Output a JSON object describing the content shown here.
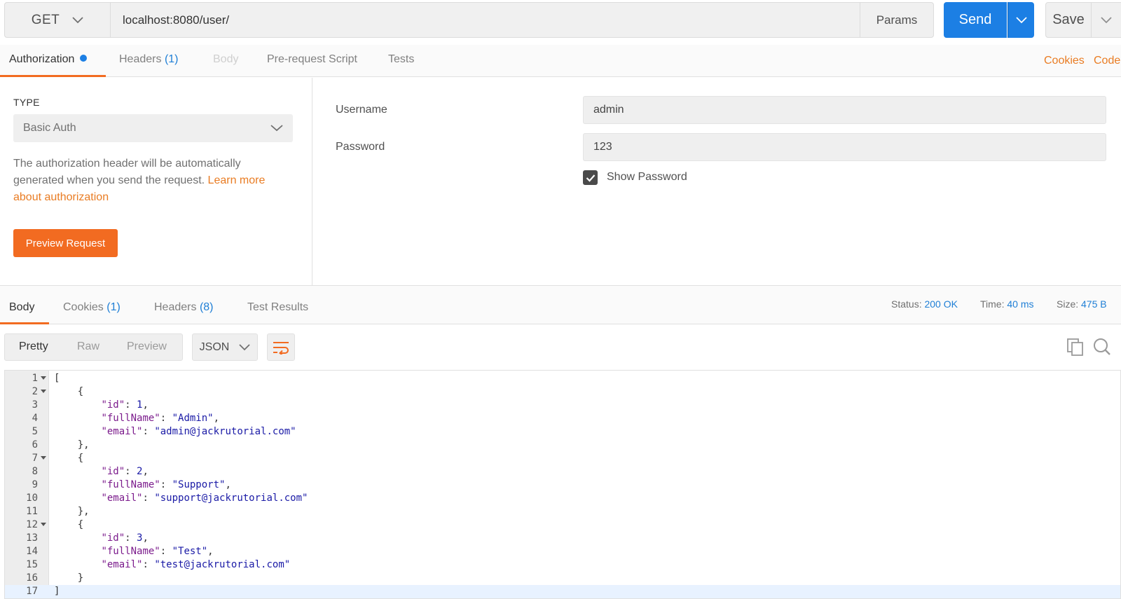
{
  "request": {
    "method": "GET",
    "url": "localhost:8080/user/",
    "params_label": "Params",
    "send_label": "Send",
    "save_label": "Save"
  },
  "request_tabs": {
    "authorization": "Authorization",
    "headers": "Headers",
    "headers_count": "(1)",
    "body": "Body",
    "pre_request": "Pre-request Script",
    "tests": "Tests",
    "cookies": "Cookies",
    "code": "Code"
  },
  "auth": {
    "type_label": "TYPE",
    "type_value": "Basic Auth",
    "description": "The authorization header will be automatically generated when you send the request.",
    "learn_more": "Learn more about authorization",
    "preview_button": "Preview Request",
    "username_label": "Username",
    "username_value": "admin",
    "password_label": "Password",
    "password_value": "123",
    "show_password_label": "Show Password",
    "show_password_checked": true
  },
  "response_tabs": {
    "body": "Body",
    "cookies": "Cookies",
    "cookies_count": "(1)",
    "headers": "Headers",
    "headers_count": "(8)",
    "test_results": "Test Results"
  },
  "response_status": {
    "status_label": "Status:",
    "status_value": "200 OK",
    "time_label": "Time:",
    "time_value": "40 ms",
    "size_label": "Size:",
    "size_value": "475 B"
  },
  "format": {
    "pretty": "Pretty",
    "raw": "Raw",
    "preview": "Preview",
    "language": "JSON"
  },
  "code_lines": [
    "[",
    "    {",
    "        \"id\": 1,",
    "        \"fullName\": \"Admin\",",
    "        \"email\": \"admin@jackrutorial.com\"",
    "    },",
    "    {",
    "        \"id\": 2,",
    "        \"fullName\": \"Support\",",
    "        \"email\": \"support@jackrutorial.com\"",
    "    },",
    "    {",
    "        \"id\": 3,",
    "        \"fullName\": \"Test\",",
    "        \"email\": \"test@jackrutorial.com\"",
    "    }",
    "]"
  ],
  "foldable_lines": [
    1,
    2,
    7,
    12
  ],
  "colors": {
    "accent_orange": "#f26b21",
    "send_blue": "#1c7fe4",
    "value_blue": "#1f7fd6"
  }
}
